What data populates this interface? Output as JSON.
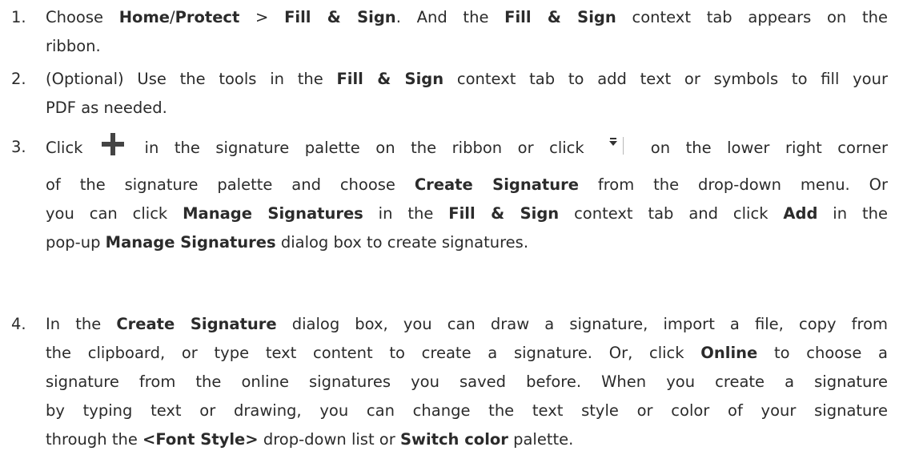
{
  "steps": [
    {
      "number": "1.",
      "lines": [
        {
          "segments": [
            {
              "text": "Choose ",
              "bold": false
            },
            {
              "text": "Home",
              "bold": true
            },
            {
              "text": "/",
              "bold": false
            },
            {
              "text": "Protect",
              "bold": true
            },
            {
              "text": " > ",
              "bold": false
            },
            {
              "text": "Fill & Sign",
              "bold": true
            },
            {
              "text": ". And the ",
              "bold": false
            },
            {
              "text": "Fill & Sign",
              "bold": true
            },
            {
              "text": " context tab appears on the",
              "bold": false
            }
          ]
        },
        {
          "segments": [
            {
              "text": "ribbon.",
              "bold": false
            }
          ]
        }
      ]
    },
    {
      "number": "2.",
      "lines": [
        {
          "segments": [
            {
              "text": "(Optional) Use the tools in the ",
              "bold": false
            },
            {
              "text": "Fill & Sign",
              "bold": true
            },
            {
              "text": " context tab to add text or symbols to fill your",
              "bold": false
            }
          ]
        },
        {
          "segments": [
            {
              "text": "PDF as needed.",
              "bold": false
            }
          ]
        }
      ]
    },
    {
      "number": "3.",
      "lines": [
        {
          "segments": [
            {
              "text": "Click ",
              "bold": false
            },
            {
              "icon": "plus-icon"
            },
            {
              "text": " in the signature palette on the ribbon or click ",
              "bold": false
            },
            {
              "icon": "dropdown-icon"
            },
            {
              "text": " on the lower right corner",
              "bold": false
            }
          ]
        },
        {
          "segments": [
            {
              "text": "of the signature palette and choose ",
              "bold": false
            },
            {
              "text": "Create Signature",
              "bold": true
            },
            {
              "text": " from the drop-down menu. Or",
              "bold": false
            }
          ]
        },
        {
          "segments": [
            {
              "text": "you can click ",
              "bold": false
            },
            {
              "text": "Manage Signatures",
              "bold": true
            },
            {
              "text": " in the ",
              "bold": false
            },
            {
              "text": "Fill & Sign",
              "bold": true
            },
            {
              "text": " context tab and click ",
              "bold": false
            },
            {
              "text": "Add",
              "bold": true
            },
            {
              "text": " in the",
              "bold": false
            }
          ]
        },
        {
          "segments": [
            {
              "text": "pop-up ",
              "bold": false
            },
            {
              "text": "Manage Signatures",
              "bold": true
            },
            {
              "text": " dialog box to create signatures.",
              "bold": false
            }
          ]
        }
      ]
    },
    {
      "number": "4.",
      "lines": [
        {
          "segments": [
            {
              "text": "In the ",
              "bold": false
            },
            {
              "text": "Create Signature",
              "bold": true
            },
            {
              "text": " dialog box, you can draw a signature, import a file, copy from",
              "bold": false
            }
          ]
        },
        {
          "segments": [
            {
              "text": "the clipboard, or type text content to create a signature. Or, click ",
              "bold": false
            },
            {
              "text": "Online",
              "bold": true
            },
            {
              "text": " to choose a",
              "bold": false
            }
          ]
        },
        {
          "segments": [
            {
              "text": "signature from the online signatures you saved before. When you create a signature",
              "bold": false
            }
          ]
        },
        {
          "segments": [
            {
              "text": "by typing text or drawing, you can change the text style or color of your signature",
              "bold": false
            }
          ]
        },
        {
          "segments": [
            {
              "text": "through the ",
              "bold": false
            },
            {
              "text": "<Font Style>",
              "bold": true
            },
            {
              "text": " drop-down list or ",
              "bold": false
            },
            {
              "text": "Switch color",
              "bold": true
            },
            {
              "text": " palette.",
              "bold": false
            }
          ]
        }
      ]
    }
  ]
}
